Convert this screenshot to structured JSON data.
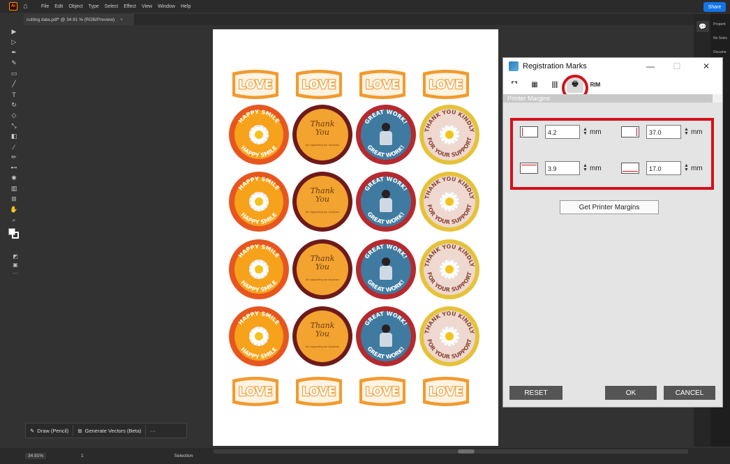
{
  "menubar": {
    "app_badge": "Ai",
    "menus": [
      "File",
      "Edit",
      "Object",
      "Type",
      "Select",
      "Effect",
      "View",
      "Window",
      "Help"
    ],
    "share": "Share"
  },
  "document_tab": {
    "title": "cutting data.pdf* @ 34.91 % (RGB/Preview)",
    "close": "×"
  },
  "artwork": {
    "love_label": "LOVE",
    "smile": {
      "top": "HAPPY SMILE",
      "bottom": "HAPPY SMILE"
    },
    "thank": {
      "text": "Thank You",
      "sub": "for supporting our business"
    },
    "great": {
      "top": "GREAT WORK!",
      "bottom": "GREAT WORK!"
    },
    "kind": {
      "top": "THANK YOU KINDLY",
      "bottom": "FOR YOUR SUPPORT"
    }
  },
  "dialog": {
    "title": "Registration Marks",
    "minimize": "—",
    "maximize": "☐",
    "close": "✕",
    "tools": [
      {
        "icon": "corner-marks-icon",
        "label": "⌜⌝"
      },
      {
        "icon": "qr-marks-icon",
        "label": "▦"
      },
      {
        "icon": "barcode-icon",
        "label": "|||"
      },
      {
        "icon": "printer-icon",
        "label": "🖶"
      },
      {
        "icon": "trim-icon",
        "label": "RIM"
      }
    ],
    "section": "Printer Margins",
    "margins": {
      "left": "4.2",
      "right": "37.0",
      "top": "3.9",
      "bottom": "17.0",
      "unit": "mm"
    },
    "get_margins": "Get Printer Margins",
    "reset": "RESET",
    "ok": "OK",
    "cancel": "CANCEL"
  },
  "bottom_tools": {
    "draw": "Draw (Pencil)",
    "generate": "Generate Vectors (Beta)",
    "more": "···"
  },
  "status": {
    "zoom": "34.91%",
    "mode": "Selection",
    "artboard": "1"
  },
  "right_panel": {
    "label1": "Properti",
    "label2": "No Selec",
    "label3": "Docume"
  },
  "colors": {
    "accent": "#1473e6",
    "highlight": "#d4101a"
  }
}
